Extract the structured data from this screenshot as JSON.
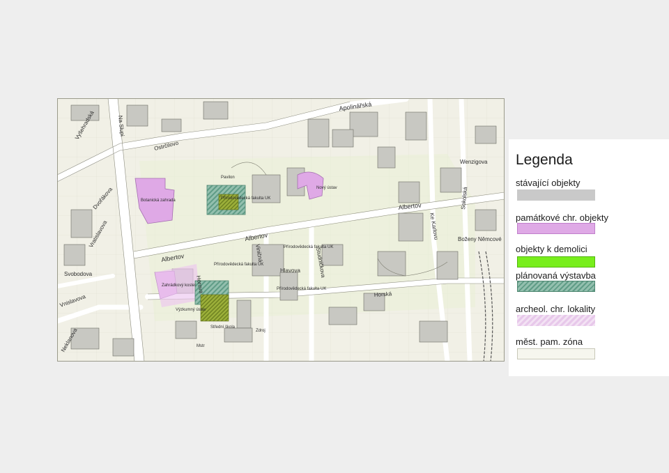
{
  "map": {
    "streets": {
      "apolinarska": "Apolinářská",
      "albertov_top": "Albertov",
      "albertov_mid": "Albertov",
      "albertov_left": "Albertov",
      "ke_karlovu": "Ke Karlovu",
      "sokolska": "Sokolská",
      "boz_nemcove": "Boženy Němcové",
      "horska": "Horská",
      "hlavova": "Hlavova",
      "studnickova": "Studničkova",
      "venceslava": "Viničná",
      "na_slupi": "Na Slupi",
      "vyton": "Vyšehradská",
      "horova": "Horova",
      "svobodova": "Svobodova",
      "vratislavova": "Vratislavova",
      "mezibranska": "Ostrčilovo",
      "wenzigova": "Wenzigova",
      "vnislavova": "Vnislavova",
      "neklanova": "Neklanova",
      "dvorakova": "Dvořákova"
    },
    "places": {
      "fakulta_top": "Přírodovědecká fakulta UK",
      "fakulta_mid": "Přírodovědecká fakulta UK",
      "fakulta_left": "Přírodovědecká fakulta UK",
      "fakulta_bottom": "Přírodovědecká fakulta UK",
      "kostel": "Zahrádkový kostel",
      "botanicka": "Botanická zahrada",
      "novy_ustav": "Nový ústav",
      "pavilon": "Pavilon",
      "vyzkum": "Výzkumný ústav",
      "zdroj": "Zdroj",
      "mstr": "Mstr",
      "stredni": "Střední škola"
    }
  },
  "legend": {
    "title": "Legenda",
    "items": [
      {
        "label": "stávající objekty"
      },
      {
        "label": "památkové chr. objekty"
      },
      {
        "label": "objekty k demolici"
      },
      {
        "label": "plánovaná výstavba"
      },
      {
        "label": "archeol. chr. lokality"
      },
      {
        "label": "měst. pam. zóna"
      }
    ]
  },
  "colors": {
    "background": "#eeeeee",
    "map_base": "#f1f0e6",
    "existing": "#c9c9c9",
    "monument": "#dfa9e6",
    "demolition": "#78ee1c",
    "planned": "#5f9c86",
    "archeo": "#e7c8ea",
    "zone": "#f6f6ee",
    "olive_block": "#8da030"
  }
}
